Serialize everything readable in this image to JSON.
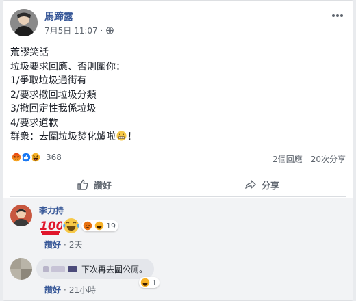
{
  "post": {
    "author": "馬蹄露",
    "timestamp": "7月5日 11:07 ·",
    "privacy_icon": "globe-icon",
    "lines": [
      "荒謬笑話",
      "垃圾要求回應、否則圍你：",
      "1/爭取垃圾通街有",
      "2/要求撤回垃圾分類",
      "3/撤回定性我係垃圾",
      "4/要求道歉"
    ],
    "last_line_before": "群衆：去圍垃圾焚化爐啦",
    "last_line_after": "！"
  },
  "stats": {
    "reaction_count": "368",
    "comments": "2個回應",
    "shares": "20次分享"
  },
  "actions": {
    "like": "讚好",
    "share": "分享"
  },
  "comments": [
    {
      "name": "李力持",
      "sticker": "💯",
      "reaction_count": "19",
      "like_label": "讚好",
      "age": "2天"
    },
    {
      "name_masked": true,
      "text": "下次再去圍公厕。",
      "reaction_count": "1",
      "like_label": "讚好",
      "age": "21小時"
    }
  ],
  "colors": {
    "link": "#385898",
    "muted": "#606770",
    "like_blue": "#1877f2",
    "angry": "#e9710f",
    "haha": "#f7b125"
  }
}
